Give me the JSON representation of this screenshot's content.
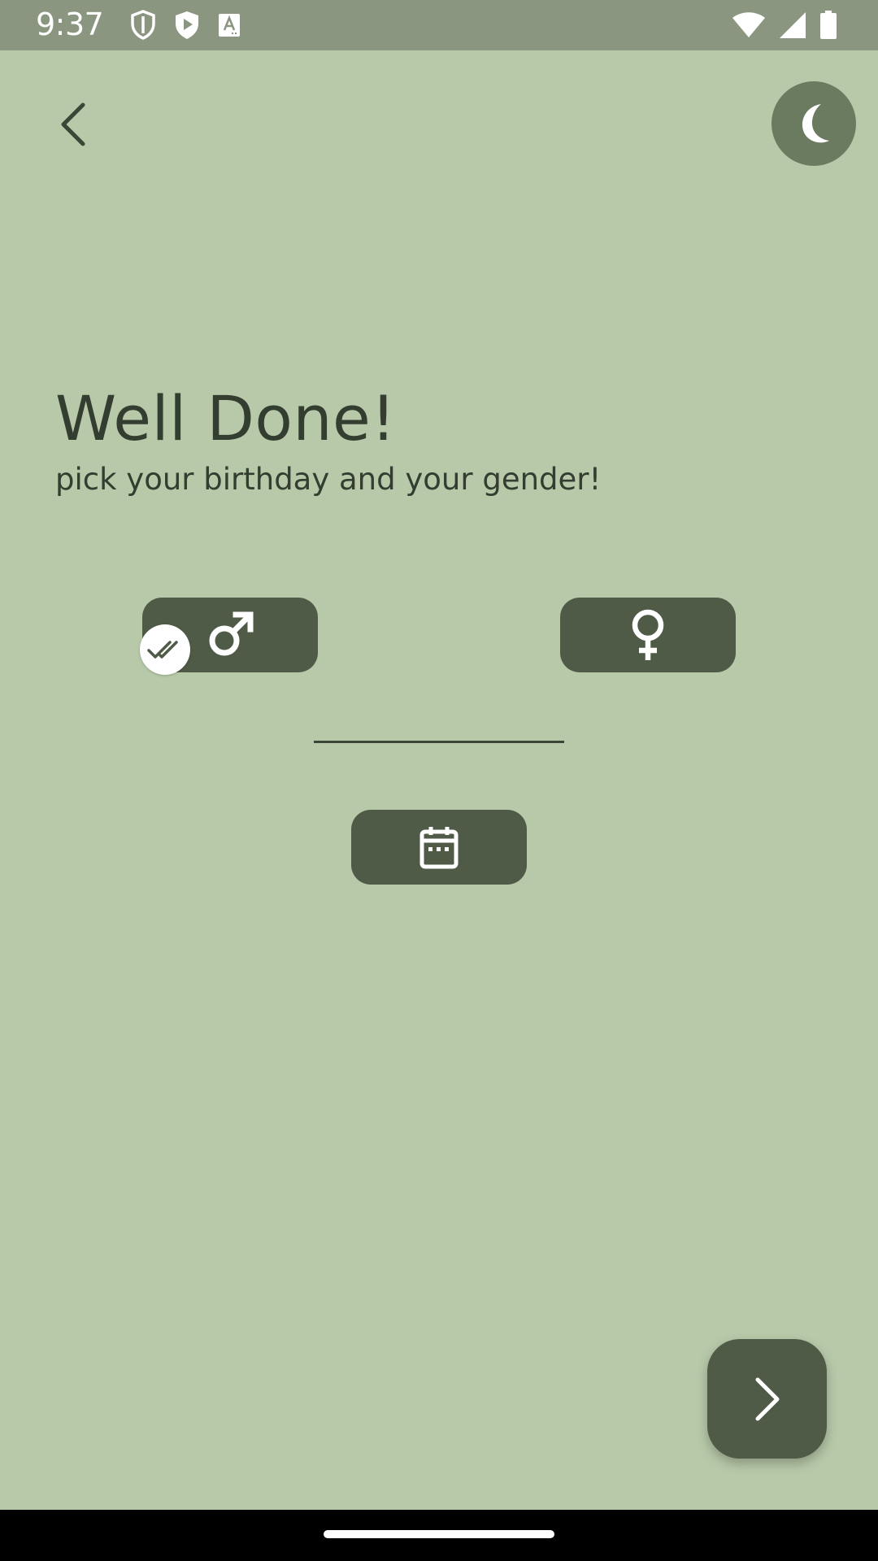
{
  "status_bar": {
    "time": "9:37",
    "left_icons": [
      "shield-icon",
      "play-protect-icon",
      "keyboard-a-icon"
    ],
    "right_icons": [
      "wifi-icon",
      "cell-signal-icon",
      "battery-icon"
    ]
  },
  "header": {
    "back_icon": "chevron-left-icon",
    "theme_icon": "moon-icon"
  },
  "main": {
    "title": "Well Done!",
    "subtitle": "pick your birthday and your gender!",
    "gender": {
      "male_icon": "male-symbol-icon",
      "female_icon": "female-symbol-icon",
      "selected": "male"
    },
    "birthday": {
      "value": "",
      "button_icon": "calendar-icon"
    }
  },
  "fab": {
    "icon": "chevron-right-icon"
  },
  "colors": {
    "background": "#b8c9a9",
    "status_bar": "#8a9680",
    "button": "#4f5b47",
    "theme_button": "#6a7b5f",
    "text": "#333d30"
  }
}
